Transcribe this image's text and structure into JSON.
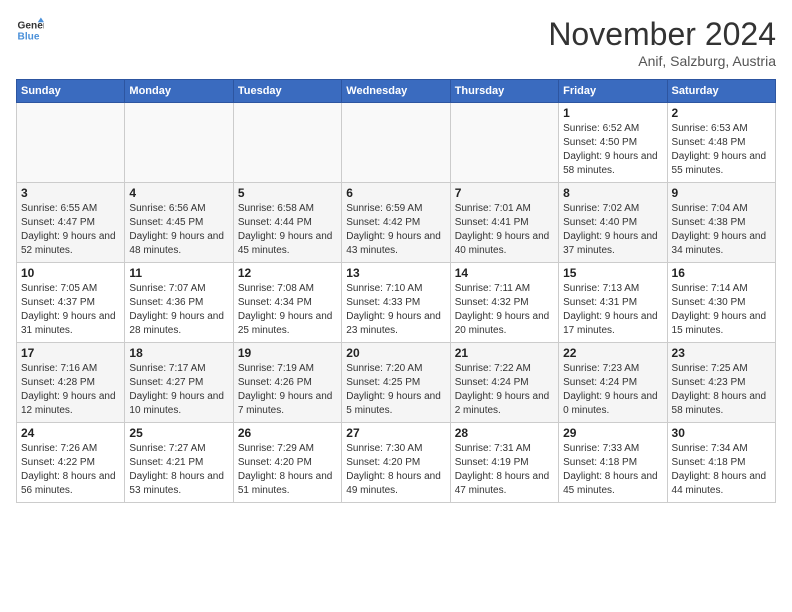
{
  "logo": {
    "line1": "General",
    "line2": "Blue"
  },
  "title": "November 2024",
  "location": "Anif, Salzburg, Austria",
  "days_of_week": [
    "Sunday",
    "Monday",
    "Tuesday",
    "Wednesday",
    "Thursday",
    "Friday",
    "Saturday"
  ],
  "weeks": [
    [
      {
        "day": "",
        "info": ""
      },
      {
        "day": "",
        "info": ""
      },
      {
        "day": "",
        "info": ""
      },
      {
        "day": "",
        "info": ""
      },
      {
        "day": "",
        "info": ""
      },
      {
        "day": "1",
        "info": "Sunrise: 6:52 AM\nSunset: 4:50 PM\nDaylight: 9 hours\nand 58 minutes."
      },
      {
        "day": "2",
        "info": "Sunrise: 6:53 AM\nSunset: 4:48 PM\nDaylight: 9 hours\nand 55 minutes."
      }
    ],
    [
      {
        "day": "3",
        "info": "Sunrise: 6:55 AM\nSunset: 4:47 PM\nDaylight: 9 hours\nand 52 minutes."
      },
      {
        "day": "4",
        "info": "Sunrise: 6:56 AM\nSunset: 4:45 PM\nDaylight: 9 hours\nand 48 minutes."
      },
      {
        "day": "5",
        "info": "Sunrise: 6:58 AM\nSunset: 4:44 PM\nDaylight: 9 hours\nand 45 minutes."
      },
      {
        "day": "6",
        "info": "Sunrise: 6:59 AM\nSunset: 4:42 PM\nDaylight: 9 hours\nand 43 minutes."
      },
      {
        "day": "7",
        "info": "Sunrise: 7:01 AM\nSunset: 4:41 PM\nDaylight: 9 hours\nand 40 minutes."
      },
      {
        "day": "8",
        "info": "Sunrise: 7:02 AM\nSunset: 4:40 PM\nDaylight: 9 hours\nand 37 minutes."
      },
      {
        "day": "9",
        "info": "Sunrise: 7:04 AM\nSunset: 4:38 PM\nDaylight: 9 hours\nand 34 minutes."
      }
    ],
    [
      {
        "day": "10",
        "info": "Sunrise: 7:05 AM\nSunset: 4:37 PM\nDaylight: 9 hours\nand 31 minutes."
      },
      {
        "day": "11",
        "info": "Sunrise: 7:07 AM\nSunset: 4:36 PM\nDaylight: 9 hours\nand 28 minutes."
      },
      {
        "day": "12",
        "info": "Sunrise: 7:08 AM\nSunset: 4:34 PM\nDaylight: 9 hours\nand 25 minutes."
      },
      {
        "day": "13",
        "info": "Sunrise: 7:10 AM\nSunset: 4:33 PM\nDaylight: 9 hours\nand 23 minutes."
      },
      {
        "day": "14",
        "info": "Sunrise: 7:11 AM\nSunset: 4:32 PM\nDaylight: 9 hours\nand 20 minutes."
      },
      {
        "day": "15",
        "info": "Sunrise: 7:13 AM\nSunset: 4:31 PM\nDaylight: 9 hours\nand 17 minutes."
      },
      {
        "day": "16",
        "info": "Sunrise: 7:14 AM\nSunset: 4:30 PM\nDaylight: 9 hours\nand 15 minutes."
      }
    ],
    [
      {
        "day": "17",
        "info": "Sunrise: 7:16 AM\nSunset: 4:28 PM\nDaylight: 9 hours\nand 12 minutes."
      },
      {
        "day": "18",
        "info": "Sunrise: 7:17 AM\nSunset: 4:27 PM\nDaylight: 9 hours\nand 10 minutes."
      },
      {
        "day": "19",
        "info": "Sunrise: 7:19 AM\nSunset: 4:26 PM\nDaylight: 9 hours\nand 7 minutes."
      },
      {
        "day": "20",
        "info": "Sunrise: 7:20 AM\nSunset: 4:25 PM\nDaylight: 9 hours\nand 5 minutes."
      },
      {
        "day": "21",
        "info": "Sunrise: 7:22 AM\nSunset: 4:24 PM\nDaylight: 9 hours\nand 2 minutes."
      },
      {
        "day": "22",
        "info": "Sunrise: 7:23 AM\nSunset: 4:24 PM\nDaylight: 9 hours\nand 0 minutes."
      },
      {
        "day": "23",
        "info": "Sunrise: 7:25 AM\nSunset: 4:23 PM\nDaylight: 8 hours\nand 58 minutes."
      }
    ],
    [
      {
        "day": "24",
        "info": "Sunrise: 7:26 AM\nSunset: 4:22 PM\nDaylight: 8 hours\nand 56 minutes."
      },
      {
        "day": "25",
        "info": "Sunrise: 7:27 AM\nSunset: 4:21 PM\nDaylight: 8 hours\nand 53 minutes."
      },
      {
        "day": "26",
        "info": "Sunrise: 7:29 AM\nSunset: 4:20 PM\nDaylight: 8 hours\nand 51 minutes."
      },
      {
        "day": "27",
        "info": "Sunrise: 7:30 AM\nSunset: 4:20 PM\nDaylight: 8 hours\nand 49 minutes."
      },
      {
        "day": "28",
        "info": "Sunrise: 7:31 AM\nSunset: 4:19 PM\nDaylight: 8 hours\nand 47 minutes."
      },
      {
        "day": "29",
        "info": "Sunrise: 7:33 AM\nSunset: 4:18 PM\nDaylight: 8 hours\nand 45 minutes."
      },
      {
        "day": "30",
        "info": "Sunrise: 7:34 AM\nSunset: 4:18 PM\nDaylight: 8 hours\nand 44 minutes."
      }
    ]
  ]
}
